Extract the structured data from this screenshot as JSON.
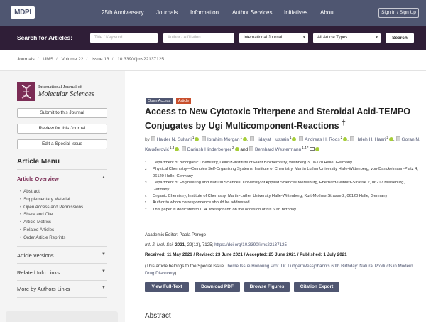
{
  "header": {
    "logo": "MDPI",
    "nav": [
      "25th Anniversary",
      "Journals",
      "Information",
      "Author Services",
      "Initiatives",
      "About"
    ],
    "signin": "Sign In / Sign Up"
  },
  "search": {
    "label": "Search for Articles:",
    "title_placeholder": "Title / Keyword",
    "author_placeholder": "Author / Affiliation",
    "journal_value": "International Journal ...",
    "type_value": "All Article Types",
    "button": "Search"
  },
  "breadcrumb": [
    "Journals",
    "IJMS",
    "Volume 22",
    "Issue 13",
    "10.3390/ijms22137125"
  ],
  "sidebar": {
    "journal_line1": "International Journal of",
    "journal_line2": "Molecular Sciences",
    "buttons": [
      "Submit to this Journal",
      "Review for this Journal",
      "Edit a Special Issue"
    ],
    "menu_title": "Article Menu",
    "overview_title": "Article Overview",
    "overview_items": [
      "Abstract",
      "Supplementary Material",
      "Open Access and Permissions",
      "Share and Cite",
      "Article Metrics",
      "Related Articles",
      "Order Article Reprints"
    ],
    "sections": [
      "Article Versions",
      "Related Info Links",
      "More by Authors Links"
    ]
  },
  "article": {
    "badge_open": "Open Access",
    "badge_type": "Article",
    "title": "Access to New Cytotoxic Triterpene and Steroidal Acid-TEMPO Conjugates by Ugi Multicomponent-Reactions",
    "title_mark": "†",
    "by": "by",
    "authors": [
      {
        "name": "Haider N. Sultani",
        "sup": "1"
      },
      {
        "name": "Ibrahim Morgan",
        "sup": "1"
      },
      {
        "name": "Hidayat Hussain",
        "sup": "1"
      },
      {
        "name": "Andreas H. Roos",
        "sup": "2"
      },
      {
        "name": "Haleh H. Haeri",
        "sup": "2"
      },
      {
        "name": "Goran N. Kaluđerović",
        "sup": "1,3"
      },
      {
        "name": "Dariush Hinderberger",
        "sup": "2"
      },
      {
        "name": "Bernhard Westermann",
        "sup": "1,4,*"
      }
    ],
    "and": "and",
    "affiliations": [
      {
        "num": "1",
        "text": "Department of Bioorganic Chemistry, Leibniz-Institute of Plant Biochemistry, Weinberg 3, 06120 Halle, Germany"
      },
      {
        "num": "2",
        "text": "Physical Chemistry—Complex Self-Organizing Systems, Institute of Chemistry, Martin Luther University Halle-Wittenberg, von-Danckelmann-Platz 4, 06120 Halle, Germany"
      },
      {
        "num": "3",
        "text": "Department of Engineering and Natural Sciences, University of Applied Sciences Merseburg, Eberhard-Leibnitz-Strasse 2, 06217 Merseburg, Germany"
      },
      {
        "num": "4",
        "text": "Organic Chemistry, Institute of Chemistry, Martin-Luther University Halle-Wittenberg, Kurt-Mothes-Strasse 2, 06120 Halle, Germany"
      },
      {
        "num": "*",
        "text": "Author to whom correspondence should be addressed."
      },
      {
        "num": "†",
        "text": "This paper is dedicated to L. A. Wessjohann on the occasion of his 60th birthday."
      }
    ],
    "editor": "Academic Editor: Paola Perego",
    "citation_journal": "Int. J. Mol. Sci.",
    "citation_year": "2021",
    "citation_rest": ", 22(13), 7125;",
    "citation_doi": "https://doi.org/10.3390/ijms22137125",
    "dates": "Received: 11 May 2021 / Revised: 23 June 2021 / Accepted: 25 June 2021 / Published: 1 July 2021",
    "belongs_prefix": "(This article belongs to the Special Issue",
    "belongs_link": "Theme Issue Honoring Prof. Dr. Ludger Wessjohann's 60th Birthday: Natural Products in Modern Drug Discovery",
    "belongs_suffix": ")",
    "buttons": [
      "View Full-Text",
      "Download PDF",
      "Browse Figures",
      "Citation Export"
    ],
    "abstract_heading": "Abstract"
  },
  "colors": {
    "nav_bg": "#4f5671",
    "search_bg": "#2f1e37",
    "accent": "#7b2c55",
    "orcid": "#a6ce39"
  }
}
